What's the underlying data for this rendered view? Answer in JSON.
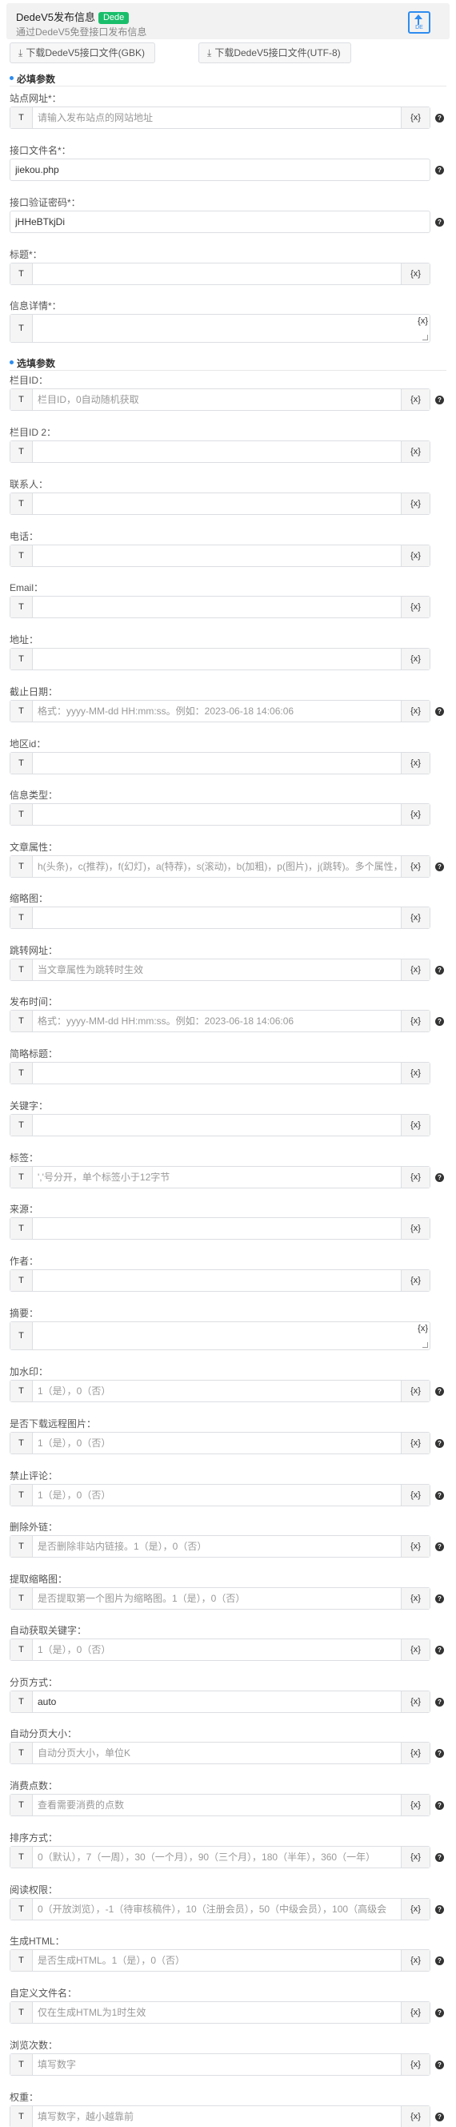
{
  "header": {
    "title": "DedeV5发布信息",
    "badge": "Dede",
    "subtitle": "通过DedeV5免登接口发布信息",
    "upload_icon_text": "DE"
  },
  "buttons": {
    "gbk": "下载DedeV5接口文件(GBK)",
    "utf8": "下载DedeV5接口文件(UTF-8)"
  },
  "sections": {
    "required": "必填参数",
    "optional": "选填参数"
  },
  "prefix": "T",
  "suffix": "{x}",
  "help": "?",
  "fields": {
    "site_url": {
      "label": "站点网址*：",
      "placeholder": "请输入发布站点的网站地址"
    },
    "api_file": {
      "label": "接口文件名*：",
      "value": "jiekou.php"
    },
    "api_pass": {
      "label": "接口验证密码*：",
      "value": "jHHeBTkjDi"
    },
    "title": {
      "label": "标题*："
    },
    "body": {
      "label": "信息详情*："
    },
    "cat_id": {
      "label": "栏目ID：",
      "placeholder": "栏目ID，0自动随机获取"
    },
    "cat_id2": {
      "label": "栏目ID 2："
    },
    "contact": {
      "label": "联系人："
    },
    "phone": {
      "label": "电话："
    },
    "email": {
      "label": "Email："
    },
    "address": {
      "label": "地址："
    },
    "deadline": {
      "label": "截止日期：",
      "placeholder": "格式：yyyy-MM-dd HH:mm:ss。例如：2023-06-18 14:06:06"
    },
    "region": {
      "label": "地区id："
    },
    "info_type": {
      "label": "信息类型："
    },
    "attr": {
      "label": "文章属性：",
      "placeholder": "h(头条)，c(推荐)，f(幻灯)，a(特荐)，s(滚动)，b(加粗)，p(图片)，j(跳转)。多个属性，英"
    },
    "thumb": {
      "label": "缩略图："
    },
    "jump": {
      "label": "跳转网址：",
      "placeholder": "当文章属性为跳转时生效"
    },
    "pubtime": {
      "label": "发布时间：",
      "placeholder": "格式：yyyy-MM-dd HH:mm:ss。例如：2023-06-18 14:06:06"
    },
    "short_title": {
      "label": "简略标题："
    },
    "keywords": {
      "label": "关键字："
    },
    "tags": {
      "label": "标签：",
      "placeholder": "','号分开，单个标签小于12字节"
    },
    "source": {
      "label": "来源："
    },
    "author": {
      "label": "作者："
    },
    "summary": {
      "label": "摘要："
    },
    "watermark": {
      "label": "加水印：",
      "placeholder": "1（是），0（否）"
    },
    "remote_img": {
      "label": "是否下载远程图片：",
      "placeholder": "1（是），0（否）"
    },
    "no_comment": {
      "label": "禁止评论：",
      "placeholder": "1（是），0（否）"
    },
    "del_links": {
      "label": "删除外链：",
      "placeholder": "是否删除非站内链接。1（是），0（否）"
    },
    "first_img": {
      "label": "提取缩略图：",
      "placeholder": "是否提取第一个图片为缩略图。1（是），0（否）"
    },
    "auto_kw": {
      "label": "自动获取关键字：",
      "placeholder": "1（是），0（否）"
    },
    "paging": {
      "label": "分页方式：",
      "value": "auto"
    },
    "page_size": {
      "label": "自动分页大小：",
      "placeholder": "自动分页大小，单位K"
    },
    "points": {
      "label": "消费点数：",
      "placeholder": "查看需要消费的点数"
    },
    "sort": {
      "label": "排序方式：",
      "placeholder": "0（默认），7（一周），30（一个月），90（三个月），180（半年），360（一年）"
    },
    "rank": {
      "label": "阅读权限：",
      "placeholder": "0（开放浏览），-1（待审核稿件），10（注册会员），50（中级会员），100（高级会"
    },
    "html": {
      "label": "生成HTML：",
      "placeholder": "是否生成HTML。1（是），0（否）"
    },
    "filename": {
      "label": "自定义文件名：",
      "placeholder": "仅在生成HTML为1时生效"
    },
    "views": {
      "label": "浏览次数：",
      "placeholder": "填写数字"
    },
    "weight": {
      "label": "权重：",
      "placeholder": "填写数字，越小越靠前"
    }
  }
}
